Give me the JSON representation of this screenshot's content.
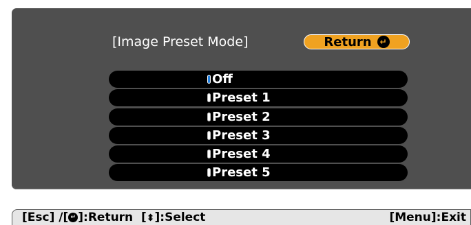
{
  "dialog": {
    "title": "[Image Preset Mode]",
    "return_label": "Return",
    "return_icon": "enter-icon"
  },
  "options": [
    {
      "label": "Off",
      "selected": true
    },
    {
      "label": "Preset 1",
      "selected": false
    },
    {
      "label": "Preset 2",
      "selected": false
    },
    {
      "label": "Preset 3",
      "selected": false
    },
    {
      "label": "Preset 4",
      "selected": false
    },
    {
      "label": "Preset 5",
      "selected": false
    }
  ],
  "footer": {
    "esc_text": "[Esc] /[",
    "return_text": "]:Return",
    "select_open": "[",
    "select_text": "]:Select",
    "menu_exit": "[Menu]:Exit"
  },
  "colors": {
    "panel": "#4f4f4f",
    "accent": "#f0a221",
    "option_bg": "#000000",
    "selected_radio": "#1f7fe0",
    "footer_bg": "#e6e6e6"
  }
}
